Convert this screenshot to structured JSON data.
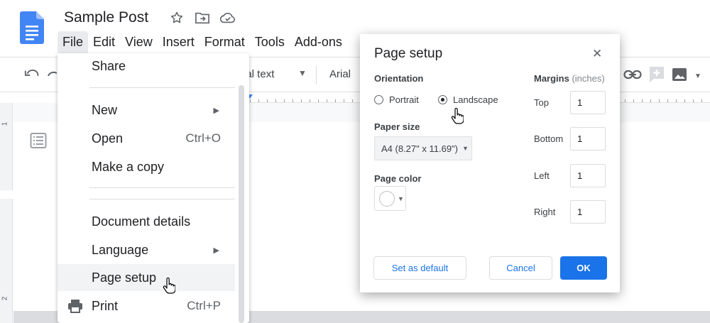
{
  "document": {
    "title": "Sample Post"
  },
  "menubar": {
    "items": [
      {
        "label": "File",
        "active": true
      },
      {
        "label": "Edit"
      },
      {
        "label": "View"
      },
      {
        "label": "Insert"
      },
      {
        "label": "Format"
      },
      {
        "label": "Tools"
      },
      {
        "label": "Add-ons"
      }
    ]
  },
  "toolbar": {
    "style_value": "nal text",
    "font_value": "Arial"
  },
  "ruler": {
    "vertical_numbers": [
      "1",
      "2"
    ]
  },
  "file_menu": {
    "share": "Share",
    "new": "New",
    "open": "Open",
    "open_shortcut": "Ctrl+O",
    "make_copy": "Make a copy",
    "document_details": "Document details",
    "language": "Language",
    "page_setup": "Page setup",
    "print": "Print",
    "print_shortcut": "Ctrl+P"
  },
  "dialog": {
    "title": "Page setup",
    "orientation_label": "Orientation",
    "portrait_label": "Portrait",
    "landscape_label": "Landscape",
    "selected_orientation": "landscape",
    "paper_size_label": "Paper size",
    "paper_size_value": "A4 (8.27\" x 11.69\")",
    "page_color_label": "Page color",
    "page_color_value": "#ffffff",
    "margins_label": "Margins",
    "margins_unit": "(inches)",
    "margins": {
      "top": {
        "label": "Top",
        "value": "1"
      },
      "bottom": {
        "label": "Bottom",
        "value": "1"
      },
      "left": {
        "label": "Left",
        "value": "1"
      },
      "right": {
        "label": "Right",
        "value": "1"
      }
    },
    "set_default_label": "Set as default",
    "cancel_label": "Cancel",
    "ok_label": "OK"
  },
  "colors": {
    "accent": "#1a73e8",
    "docs_blue": "#4285f4"
  }
}
